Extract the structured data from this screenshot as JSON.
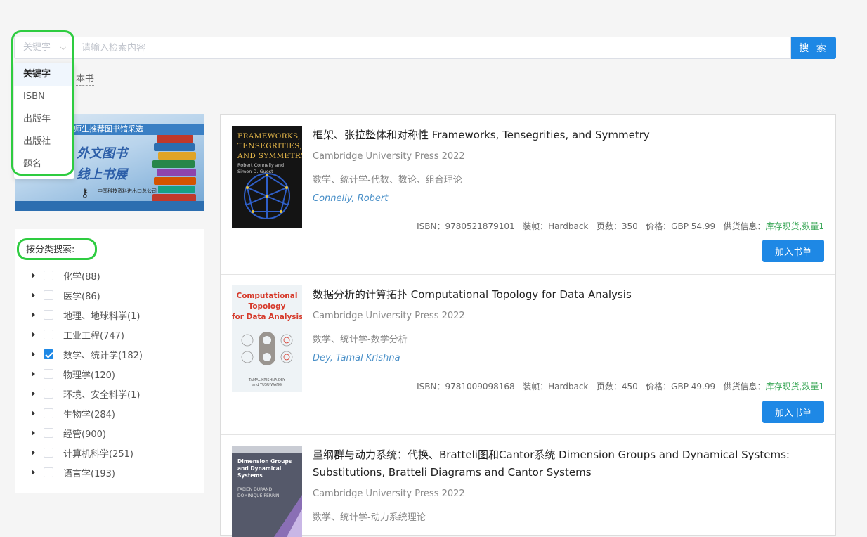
{
  "search": {
    "select_value": "关键字",
    "placeholder": "请输入检索内容",
    "button_label": "搜 索",
    "options": [
      "关键字",
      "ISBN",
      "出版年",
      "出版社",
      "题名"
    ],
    "count_text": "本书"
  },
  "banner": {
    "strip_text": "师生推荐图书馆采选",
    "line1": "外文图书",
    "line2": "线上书展",
    "publisher": "中国科技资料进出口总公司"
  },
  "categories": {
    "title": "按分类搜索:",
    "items": [
      {
        "label": "化学(88)",
        "checked": false
      },
      {
        "label": "医学(86)",
        "checked": false
      },
      {
        "label": "地理、地球科学(1)",
        "checked": false
      },
      {
        "label": "工业工程(747)",
        "checked": false
      },
      {
        "label": "数学、统计学(182)",
        "checked": true
      },
      {
        "label": "物理学(120)",
        "checked": false
      },
      {
        "label": "环境、安全科学(1)",
        "checked": false
      },
      {
        "label": "生物学(284)",
        "checked": false
      },
      {
        "label": "经管(900)",
        "checked": false
      },
      {
        "label": "计算机科学(251)",
        "checked": false
      },
      {
        "label": "语言学(193)",
        "checked": false
      }
    ]
  },
  "books": [
    {
      "title": "框架、张拉整体和对称性 Frameworks, Tensegrities, and Symmetry",
      "publisher": "Cambridge University Press 2022",
      "category": "数学、统计学-代数、数论、组合理论",
      "author": "Connelly, Robert",
      "meta": "ISBN：9780521879101   装帧：Hardback   页数：350   价格：GBP 54.99   供货信息：",
      "stock": "库存现货,数量1",
      "add_label": "加入书单",
      "cover_title": "FRAMEWORKS,\nTENSEGRITIES,\nAND SYMMETRY",
      "cover_authors": "Robert Connelly and\nSimon D. Guest"
    },
    {
      "title": "数据分析的计算拓扑 Computational Topology for Data Analysis",
      "publisher": "Cambridge University Press 2022",
      "category": "数学、统计学-数学分析",
      "author": "Dey, Tamal Krishna",
      "meta": "ISBN：9781009098168   装帧：Hardback   页数：450   价格：GBP 49.99   供货信息：",
      "stock": "库存现货,数量1",
      "add_label": "加入书单",
      "cover_title": "Computational\nTopology\nfor Data Analysis",
      "cover_authors": "TAMAL KRISHNA DEY\nand YUSU WANG"
    },
    {
      "title": "量纲群与动力系统：代换、Bratteli图和Cantor系统 Dimension Groups and Dynamical Systems: Substitutions, Bratteli Diagrams and Cantor Systems",
      "publisher": "Cambridge University Press 2022",
      "category": "数学、统计学-动力系统理论",
      "cover_title": "Dimension Groups\nand Dynamical\nSystems",
      "cover_authors": "FABIEN DURAND\nDOMINIQUE PERRIN"
    }
  ],
  "colors": {
    "accent": "#1e88e5",
    "highlight": "#2ecc40",
    "stock": "#3aa757"
  }
}
